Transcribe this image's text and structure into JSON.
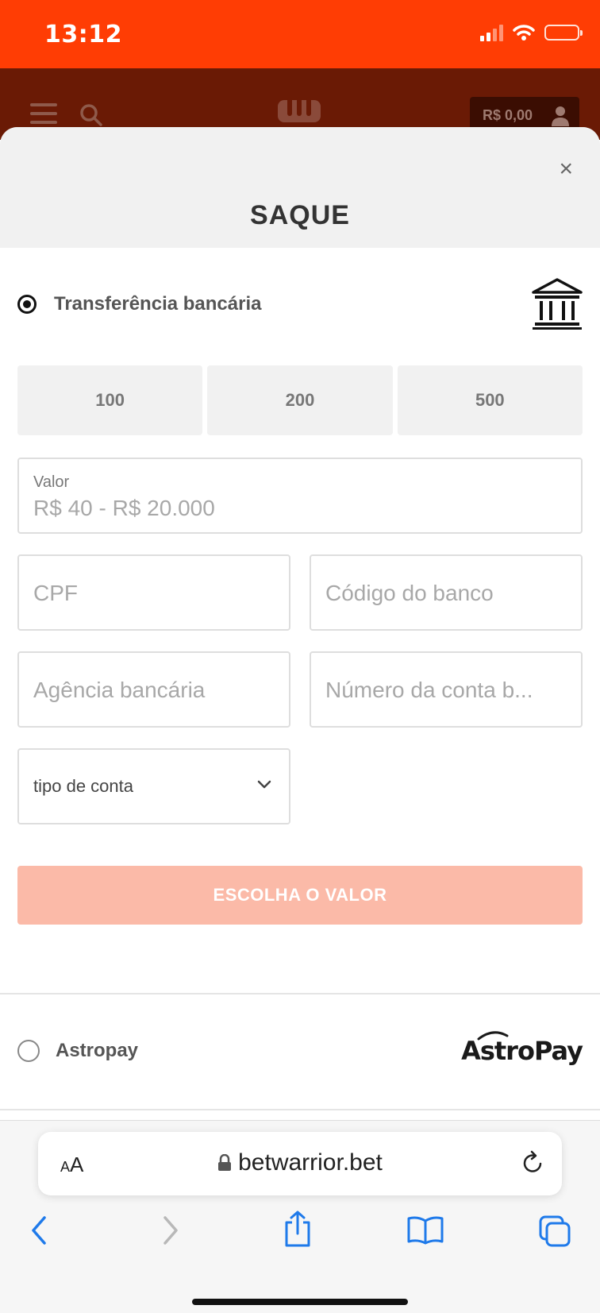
{
  "status_bar": {
    "time": "13:12",
    "icons": [
      "signal-icon",
      "wifi-icon",
      "battery-icon"
    ]
  },
  "site_header": {
    "balance": "R$ 0,00",
    "icons": [
      "menu-icon",
      "search-icon",
      "logo-icon",
      "user-icon"
    ]
  },
  "modal": {
    "title": "SAQUE",
    "close_label": "×",
    "bank_transfer": {
      "label": "Transferência bancária",
      "selected": true,
      "icon": "bank-icon",
      "presets": [
        "100",
        "200",
        "500"
      ],
      "amount": {
        "label": "Valor",
        "placeholder": "R$ 40 - R$ 20.000"
      },
      "cpf_placeholder": "CPF",
      "bank_code_placeholder": "Código do banco",
      "agency_placeholder": "Agência bancária",
      "account_number_placeholder": "Número da conta b...",
      "account_type": "tipo de conta",
      "submit_label": "ESCOLHA O VALOR"
    },
    "astropay": {
      "label": "Astropay",
      "selected": false,
      "logo_text": "AstroPay"
    }
  },
  "browser": {
    "aa_small": "A",
    "aa_big": "A",
    "url": "betwarrior.bet"
  },
  "colors": {
    "status_bar": "#ff3d04",
    "header": "#6a1a05",
    "cta_disabled": "#fbbaa8",
    "ios_blue": "#1f7aea"
  }
}
